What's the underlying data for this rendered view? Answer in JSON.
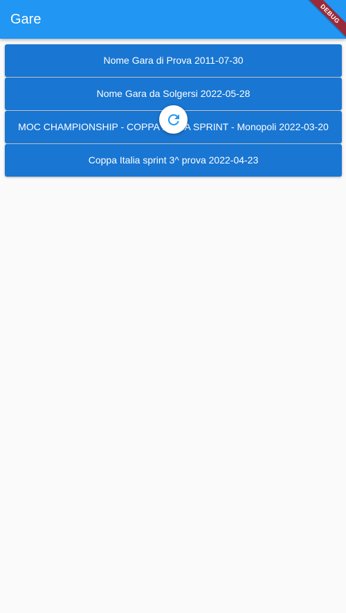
{
  "appbar": {
    "title": "Gare",
    "color": "#2196f3"
  },
  "debug_banner": {
    "label": "DEBUG"
  },
  "races": [
    {
      "label": "Nome Gara di Prova 2011-07-30"
    },
    {
      "label": "Nome Gara da Solgersi 2022-05-28"
    },
    {
      "label": "MOC CHAMPIONSHIP - COPPA ITALIA SPRINT - Monopoli 2022-03-20"
    },
    {
      "label": "Coppa Italia sprint 3^ prova 2022-04-23"
    }
  ],
  "refresh_indicator": {
    "icon": "refresh-icon",
    "color": "#2196f3"
  },
  "button_color": "#1976d2"
}
